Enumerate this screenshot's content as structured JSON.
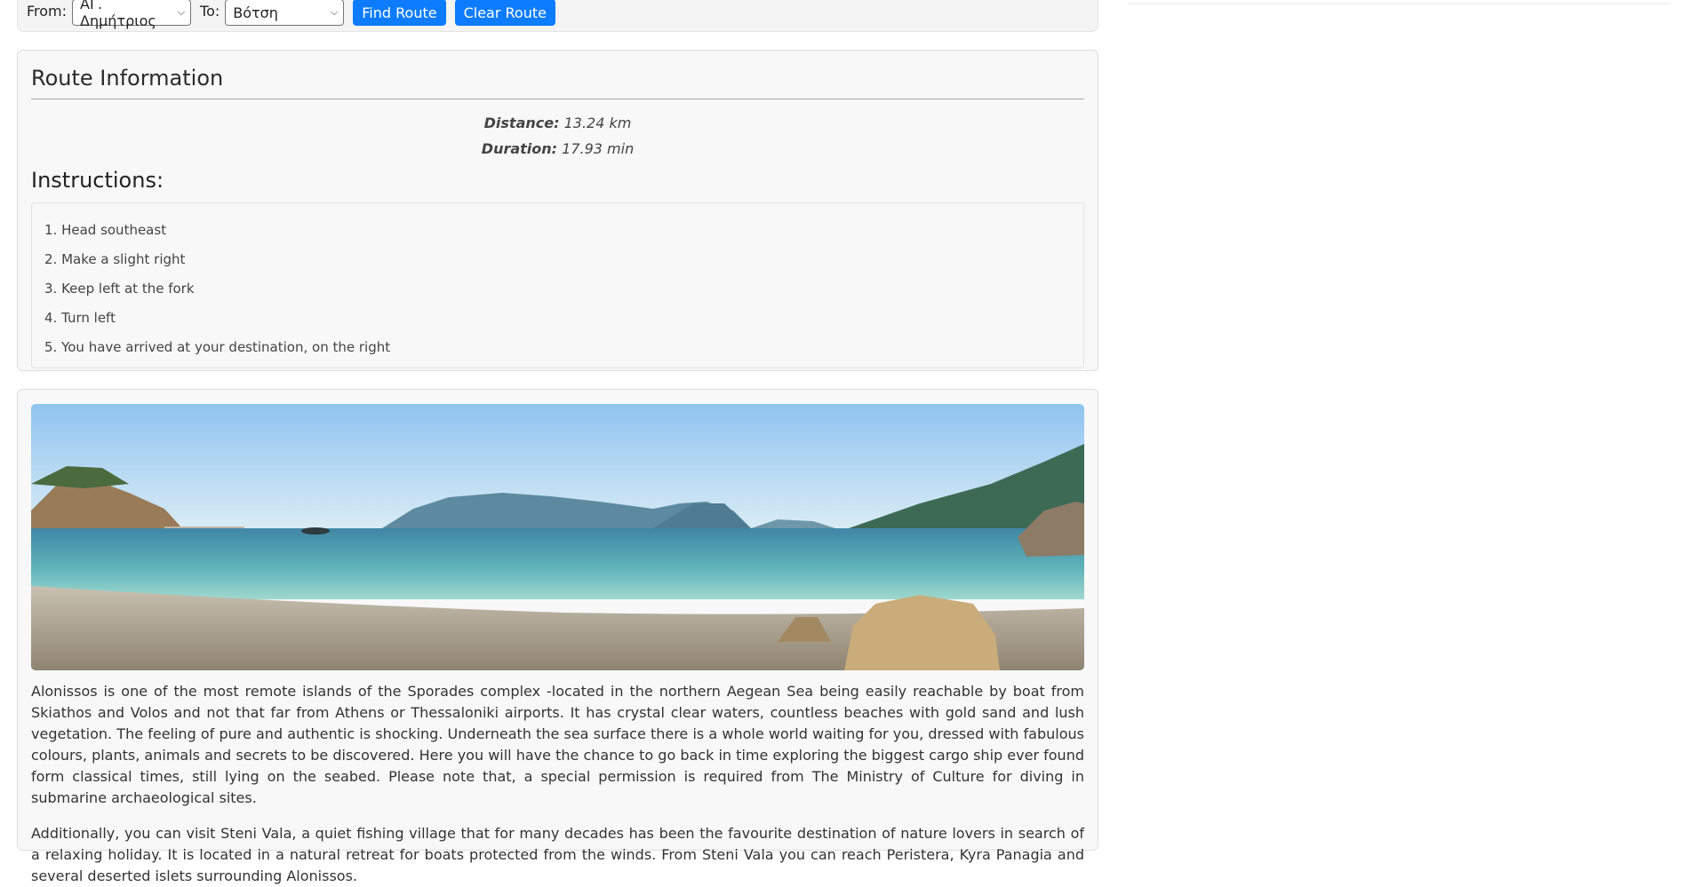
{
  "route_form": {
    "from_label": "From:",
    "from_value": "ΑΓ. Δημήτριος",
    "to_label": "To:",
    "to_value": "Βότση",
    "find_button": "Find Route",
    "clear_button": "Clear Route"
  },
  "route_info": {
    "title": "Route Information",
    "distance_label": "Distance:",
    "distance_value": "13.24 km",
    "duration_label": "Duration:",
    "duration_value": "17.93 min",
    "instructions_title": "Instructions:",
    "instructions": [
      "1. Head southeast",
      "2. Make a slight right",
      "3. Keep left at the fork",
      "4. Turn left",
      "5. You have arrived at your destination, on the right"
    ]
  },
  "about": {
    "paragraphs": [
      "Alonissos is one of the most remote islands of the Sporades complex -located in the northern Aegean Sea being easily reachable by boat from Skiathos and Volos and not that far from Athens or Thessaloniki airports. It has crystal clear waters, countless beaches with gold sand and lush vegetation. The feeling of pure and authentic is shocking. Underneath the sea surface there is a whole world waiting for you, dressed with fabulous colours, plants, animals and secrets to be discovered. Here you will have the chance to go back in time exploring the biggest cargo ship ever found form classical times, still lying on the seabed. Please note that, a special permission is required from The Ministry of Culture for diving in submarine archaeological sites.",
      "Additionally, you can visit Steni Vala, a quiet fishing village that for many decades has been the favourite destination of nature lovers in search of a relaxing holiday. It is located in a natural retreat for boats protected from the winds. From Steni Vala you can reach Peristera, Kyra Panagia and several deserted islets surrounding Alonissos."
    ]
  },
  "colors": {
    "button_blue": "#0d7cff",
    "card_bg": "#f8f8f8"
  }
}
